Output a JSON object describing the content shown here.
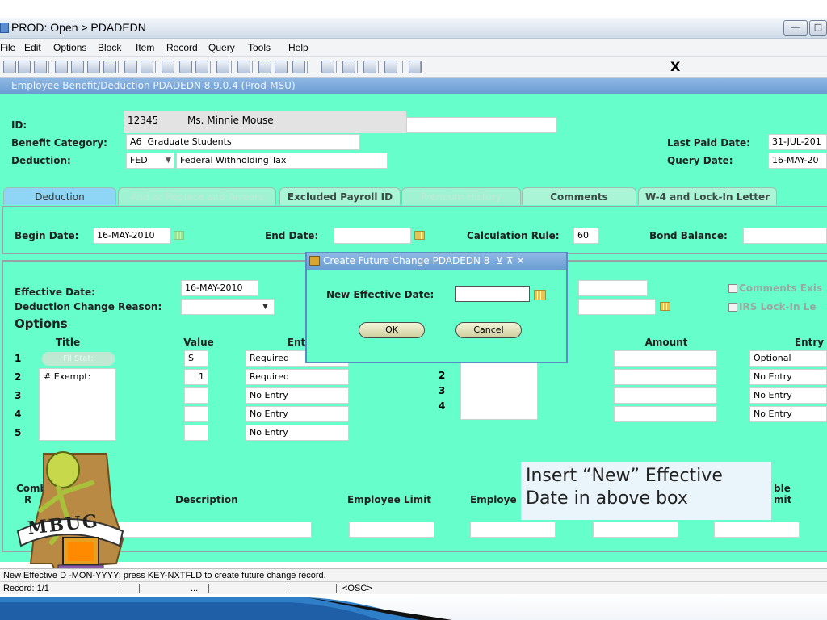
{
  "window": {
    "title": "PROD: Open > PDADEDN"
  },
  "menu": [
    {
      "label": "File",
      "u": "F",
      "rest": "ile"
    },
    {
      "label": "Edit",
      "u": "E",
      "rest": "dit"
    },
    {
      "label": "Options",
      "u": "O",
      "rest": "ptions"
    },
    {
      "label": "Block",
      "u": "B",
      "rest": "lock"
    },
    {
      "label": "Item",
      "u": "I",
      "rest": "tem"
    },
    {
      "label": "Record",
      "u": "R",
      "rest": "ecord"
    },
    {
      "label": "Query",
      "u": "Q",
      "rest": "uery"
    },
    {
      "label": "Tools",
      "u": "T",
      "rest": "ools"
    },
    {
      "label": "Help",
      "u": "H",
      "rest": "elp"
    }
  ],
  "toolbar": {
    "exit": "X"
  },
  "form": {
    "title": "Employee Benefit/Deduction  PDADEDN  8.9.0.4  (Prod-MSU)",
    "id_label": "ID:",
    "id_value": "12345",
    "id_name": "Ms. Minnie Mouse",
    "category_label": "Benefit Category:",
    "category_code": "A6",
    "category_desc": "Graduate Students",
    "deduction_label": "Deduction:",
    "deduction_code": "FED",
    "deduction_desc": "Federal Withholding Tax",
    "last_paid_label": "Last Paid Date:",
    "last_paid_value": "31-JUL-201",
    "query_date_label": "Query Date:",
    "query_date_value": "16-MAY-20"
  },
  "tabs": [
    "Deduction",
    "Add or Replace and Arrears",
    "Excluded Payroll ID",
    "Premium History",
    "Comments",
    "W-4 and Lock-In Letter"
  ],
  "deduction": {
    "begin_label": "Begin Date:",
    "begin_value": "16-MAY-2010",
    "end_label": "End Date:",
    "calc_label": "Calculation Rule:",
    "calc_value": "60",
    "bond_label": "Bond Balance:",
    "eff_label": "Effective Date:",
    "eff_value": "16-MAY-2010",
    "reason_label": "Deduction Change Reason:",
    "comments_exist": "Comments Exis",
    "irs_lock": "IRS Lock-In Le",
    "options_label": "Options",
    "col_title": "Title",
    "col_value": "Value",
    "col_entry": "Entr",
    "col_amount": "Amount",
    "col_entry2": "Entry",
    "rows": [
      {
        "n": "1",
        "title": "Fil Stat:",
        "value": "S",
        "entry": "Required"
      },
      {
        "n": "2",
        "title": "# Exempt:",
        "value": "1",
        "entry": "Required"
      },
      {
        "n": "3",
        "title": "",
        "value": "",
        "entry": "No Entry"
      },
      {
        "n": "4",
        "title": "",
        "value": "",
        "entry": "No Entry"
      },
      {
        "n": "5",
        "title": "",
        "value": "",
        "entry": "No Entry"
      }
    ],
    "right_nums": [
      "2",
      "3",
      "4"
    ],
    "right_entries": [
      "Optional",
      "No Entry",
      "No Entry",
      "No Entry"
    ],
    "comb_label": "Comb",
    "comb_label2": "R",
    "desc_label": "Description",
    "emp_limit_label": "Employee Limit",
    "employer_label": "Employe",
    "ble_label": "ble",
    "limit_label": "mit"
  },
  "dialog": {
    "title": "Create Future Change  PDADEDN  8",
    "title_icons": "⊻ ⊼ ✕",
    "label": "New Effective Date:",
    "ok": "OK",
    "cancel": "Cancel"
  },
  "note": "Insert “New” Effective Date in above box",
  "logo": {
    "text": "MBUG"
  },
  "status": {
    "line1": "New Effective D         -MON-YYYY; press KEY-NXTFLD to create future change record.",
    "record": "Record: 1/1",
    "dots": "...",
    "osc": "<OSC>"
  }
}
